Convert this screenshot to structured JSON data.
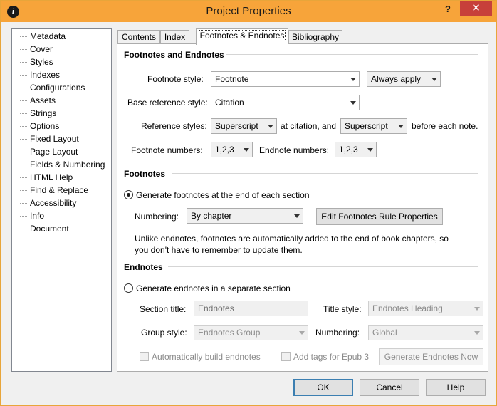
{
  "window": {
    "title": "Project Properties",
    "app_icon_glyph": "i",
    "help_glyph": "?",
    "close_glyph": "✕"
  },
  "nav": {
    "items": [
      {
        "label": "Metadata"
      },
      {
        "label": "Cover"
      },
      {
        "label": "Styles"
      },
      {
        "label": "Indexes"
      },
      {
        "label": "Configurations"
      },
      {
        "label": "Assets"
      },
      {
        "label": "Strings"
      },
      {
        "label": "Options"
      },
      {
        "label": "Fixed Layout"
      },
      {
        "label": "Page Layout"
      },
      {
        "label": "Fields & Numbering"
      },
      {
        "label": "HTML Help"
      },
      {
        "label": "Find & Replace"
      },
      {
        "label": "Accessibility"
      },
      {
        "label": "Info"
      },
      {
        "label": "Document"
      }
    ],
    "selected": "Indexes"
  },
  "tabs": [
    {
      "label": "Contents"
    },
    {
      "label": "Index"
    },
    {
      "label": "Footnotes & Endnotes"
    },
    {
      "label": "Bibliography"
    }
  ],
  "active_tab": "Footnotes & Endnotes",
  "fe": {
    "heading": "Footnotes and Endnotes",
    "footnote_style_label": "Footnote style:",
    "footnote_style_value": "Footnote",
    "apply_value": "Always apply",
    "base_ref_label": "Base reference style:",
    "base_ref_value": "Citation",
    "ref_styles_label": "Reference styles:",
    "ref_citation_value": "Superscript",
    "at_citation_text": "at citation, and",
    "ref_note_value": "Superscript",
    "before_note_text": "before each note.",
    "footnote_numbers_label": "Footnote numbers:",
    "footnote_numbers_value": "1,2,3",
    "endnote_numbers_label": "Endnote numbers:",
    "endnote_numbers_value": "1,2,3"
  },
  "footnotes": {
    "heading": "Footnotes",
    "generate_label": "Generate footnotes at the end of each section",
    "generate_checked": true,
    "numbering_label": "Numbering:",
    "numbering_value": "By chapter",
    "edit_rule_button": "Edit Footnotes Rule Properties",
    "note_line1": "Unlike endnotes, footnotes are automatically added to the end of book chapters, so",
    "note_line2": "you don't have to remember to update them."
  },
  "endnotes": {
    "heading": "Endnotes",
    "generate_label": "Generate endnotes in a separate section",
    "generate_checked": false,
    "section_title_label": "Section title:",
    "section_title_value": "Endnotes",
    "title_style_label": "Title style:",
    "title_style_value": "Endnotes Heading",
    "group_style_label": "Group style:",
    "group_style_value": "Endnotes Group",
    "numbering_label": "Numbering:",
    "numbering_value": "Global",
    "auto_build_label": "Automatically build endnotes",
    "add_tags_label": "Add tags for Epub 3",
    "generate_now_button": "Generate Endnotes Now"
  },
  "footer": {
    "ok": "OK",
    "cancel": "Cancel",
    "help": "Help"
  },
  "colors": {
    "titlebar": "#f7a43a",
    "close": "#c7403a",
    "accent_border": "#3c7fb1"
  }
}
